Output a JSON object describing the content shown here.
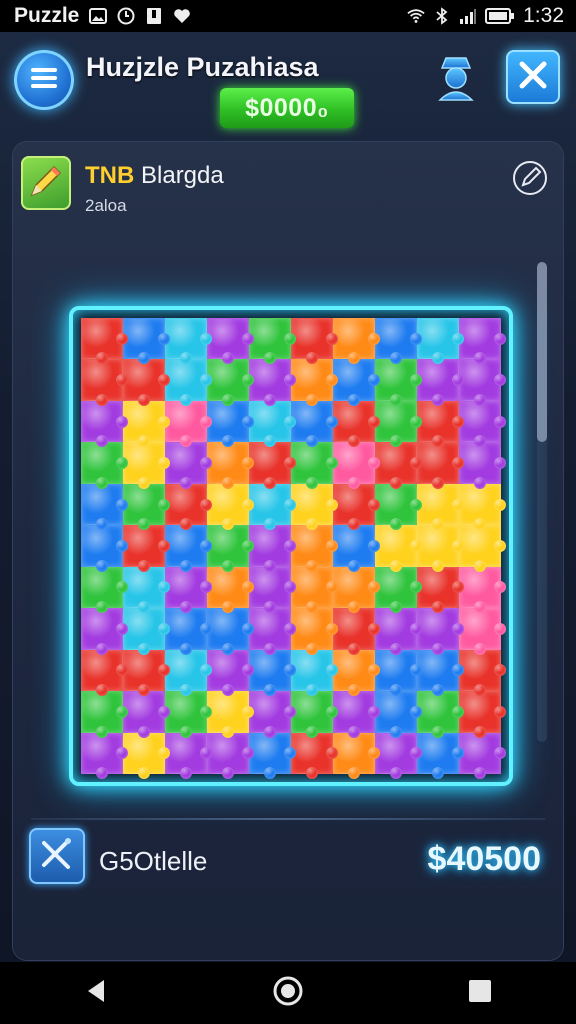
{
  "status_bar": {
    "app_name": "Puzzle",
    "time": "1:32"
  },
  "header": {
    "title": "Huzjzle Puzahiasa",
    "coins": "$0000₀"
  },
  "level": {
    "title_highlight": "TNB",
    "title_rest": "Blargda",
    "subtitle": "2aloa"
  },
  "board": {
    "cols": 10,
    "rows": 11,
    "palette": [
      "#e8322a",
      "#1e7cf0",
      "#2fc43c",
      "#ffd21e",
      "#a23be0",
      "#ff8a16",
      "#27c5e8",
      "#ff5aa0"
    ],
    "pieces": [
      0,
      1,
      6,
      4,
      2,
      0,
      5,
      1,
      6,
      4,
      0,
      0,
      6,
      2,
      4,
      5,
      1,
      2,
      4,
      4,
      4,
      3,
      7,
      1,
      6,
      1,
      0,
      2,
      0,
      4,
      2,
      3,
      4,
      5,
      0,
      2,
      7,
      0,
      0,
      4,
      1,
      2,
      0,
      3,
      6,
      3,
      0,
      2,
      3,
      3,
      1,
      0,
      1,
      2,
      4,
      5,
      1,
      3,
      3,
      3,
      2,
      6,
      4,
      5,
      4,
      5,
      5,
      2,
      0,
      7,
      4,
      6,
      1,
      1,
      4,
      5,
      0,
      4,
      4,
      7,
      0,
      0,
      6,
      4,
      1,
      6,
      5,
      1,
      1,
      0,
      2,
      4,
      2,
      3,
      4,
      2,
      4,
      1,
      2,
      0,
      4,
      3,
      4,
      4,
      1,
      0,
      5,
      4,
      1,
      4
    ]
  },
  "footer": {
    "tool_label": "G5Otlelle",
    "price": "$40500"
  },
  "colors": {
    "accent": "#35e0ff",
    "coin_green": "#2fbf25",
    "highlight": "#ffcf2e"
  },
  "icons": [
    "menu-icon",
    "profile-icon",
    "close-icon",
    "pencil-icon",
    "edit-icon",
    "tool-icon",
    "back-icon",
    "home-icon",
    "recents-icon"
  ]
}
